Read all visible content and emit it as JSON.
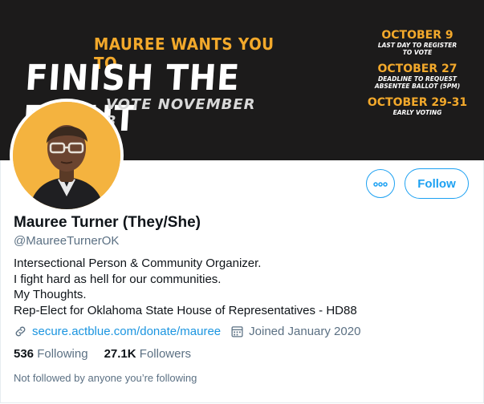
{
  "banner": {
    "kicker": "MAUREE WANTS YOU TO",
    "headline": "FINISH THE FIGHT",
    "vote": "VOTE NOVEMBER 3",
    "dates": [
      {
        "date": "OCTOBER 9",
        "sub1": "LAST DAY TO REGISTER",
        "sub2": "TO VOTE"
      },
      {
        "date": "OCTOBER 27",
        "sub1": "DEADLINE TO REQUEST",
        "sub2": "ABSENTEE BALLOT (5PM)"
      },
      {
        "date": "OCTOBER 29-31",
        "sub1": "EARLY VOTING",
        "sub2": ""
      }
    ]
  },
  "actions": {
    "more_icon": "more-horizontal-icon",
    "follow_label": "Follow"
  },
  "profile": {
    "name": "Mauree Turner (They/She)",
    "handle": "@MaureeTurnerOK",
    "bio": [
      "Intersectional Person & Community Organizer.",
      "I fight hard as hell for our communities.",
      "My Thoughts.",
      "Rep-Elect for Oklahoma State House of Representatives - HD88"
    ],
    "link": "secure.actblue.com/donate/mauree",
    "joined": "Joined January 2020"
  },
  "stats": {
    "following_count": "536",
    "following_label": "Following",
    "followers_count": "27.1K",
    "followers_label": "Followers"
  },
  "footer": {
    "not_followed": "Not followed by anyone you’re following"
  },
  "colors": {
    "accent": "#1da1f2",
    "banner_bg": "#1c1b1b",
    "banner_gold": "#f3a92b",
    "avatar_bg": "#f4b33f"
  }
}
